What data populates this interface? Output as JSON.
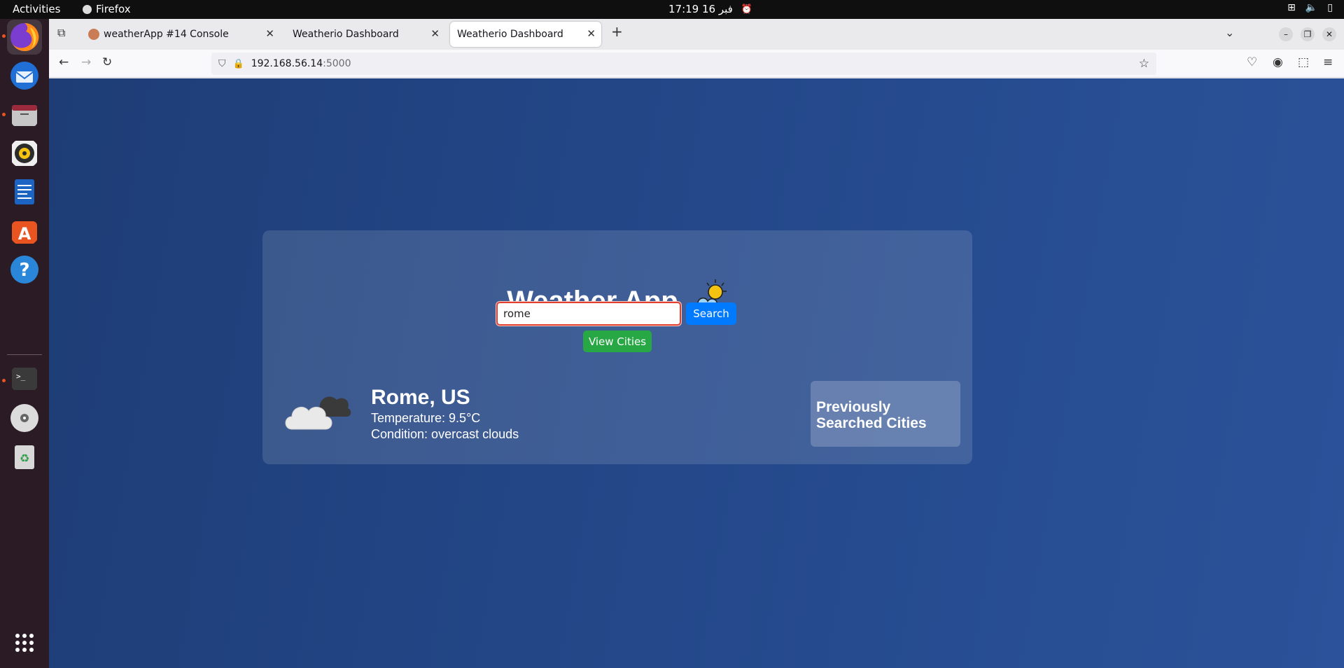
{
  "topbar": {
    "activities": "Activities",
    "app_name": "Firefox",
    "clock": "17:19  16 فبر"
  },
  "dock": {
    "items": [
      "firefox",
      "thunderbird",
      "files",
      "rhythmbox",
      "writer",
      "app-center",
      "help",
      "terminal",
      "optical-drive",
      "trash",
      "show-apps"
    ]
  },
  "browser": {
    "tabs": [
      {
        "label": "weatherApp #14 Console",
        "active": false
      },
      {
        "label": "Weatherio Dashboard",
        "active": false
      },
      {
        "label": "Weatherio Dashboard",
        "active": true
      }
    ],
    "url_host": "192.168.56.14",
    "url_port": ":5000"
  },
  "app": {
    "title": "Weather App",
    "search": {
      "value": "rome",
      "button_label": "Search"
    },
    "view_cities_label": "View Cities",
    "result": {
      "city": "Rome, US",
      "temperature": "Temperature: 9.5°C",
      "condition": "Condition: overcast clouds"
    },
    "previous_title": "Previously Searched Cities"
  },
  "colors": {
    "search_button": "#007bff",
    "view_cities_button": "#28a745",
    "page_bg": "#24488a",
    "input_border": "#e04030"
  }
}
